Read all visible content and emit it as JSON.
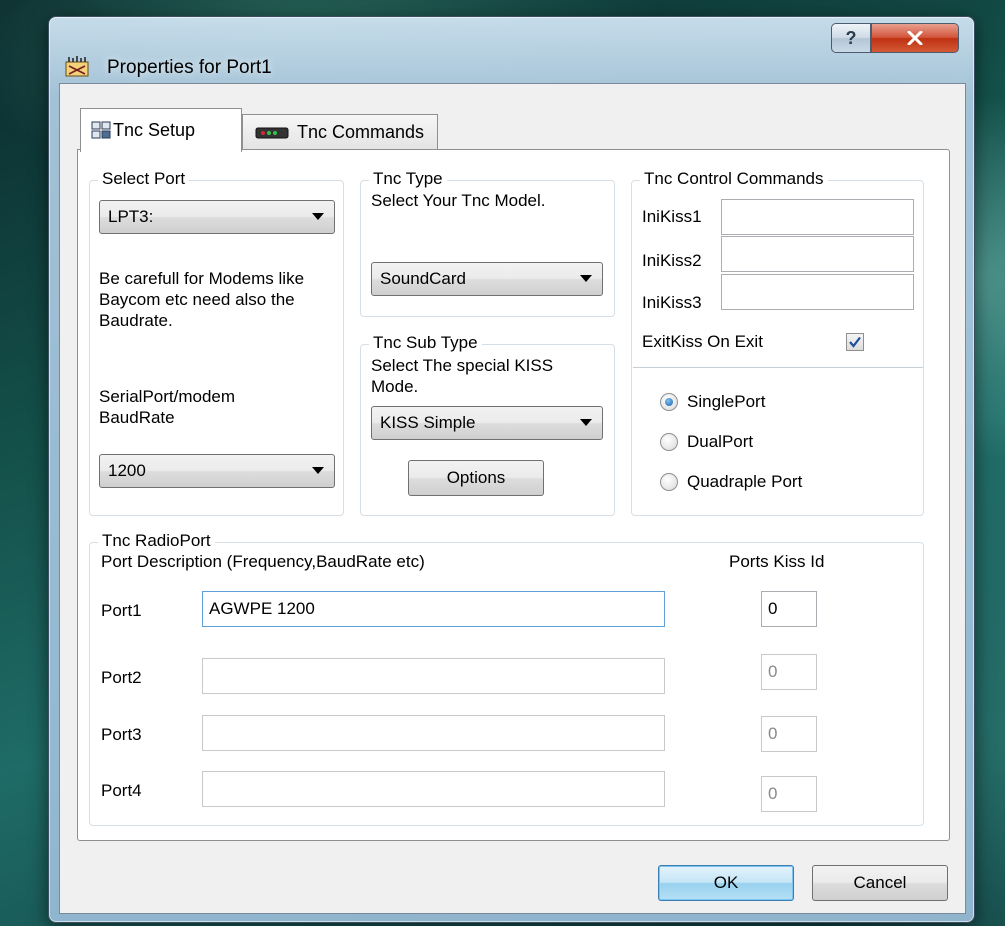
{
  "window": {
    "title": "Properties for Port1"
  },
  "tabs": [
    {
      "label": "Tnc Setup",
      "icon": "tnc-setup-icon",
      "selected": true
    },
    {
      "label": "Tnc Commands",
      "icon": "modem-icon",
      "selected": false
    }
  ],
  "select_port": {
    "legend": "Select Port",
    "port_value": "LPT3:",
    "note": "Be carefull for Modems like Baycom etc need also the Baudrate.",
    "baud_label": "SerialPort/modem BaudRate",
    "baud_value": "1200"
  },
  "tnc_type": {
    "legend": "Tnc Type",
    "hint": "Select Your Tnc Model.",
    "value": "SoundCard"
  },
  "tnc_sub_type": {
    "legend": "Tnc Sub Type",
    "hint": "Select The special KISS Mode.",
    "value": "KISS Simple",
    "options_label": "Options"
  },
  "control_commands": {
    "legend": "Tnc Control Commands",
    "inikiss1_label": "IniKiss1",
    "inikiss2_label": "IniKiss2",
    "inikiss3_label": "IniKiss3",
    "inikiss1_value": "",
    "inikiss2_value": "",
    "inikiss3_value": "",
    "exitkiss_label": "ExitKiss On Exit",
    "exitkiss_checked": true,
    "radios": [
      {
        "label": "SinglePort",
        "checked": true
      },
      {
        "label": "DualPort",
        "checked": false
      },
      {
        "label": "Quadraple Port",
        "checked": false
      }
    ]
  },
  "radio_port": {
    "legend": "Tnc RadioPort",
    "description_header": "Port Description (Frequency,BaudRate etc)",
    "kiss_id_header": "Ports Kiss Id",
    "ports": [
      {
        "label": "Port1",
        "description": "AGWPE 1200",
        "kiss_id": "0",
        "enabled": true
      },
      {
        "label": "Port2",
        "description": "",
        "kiss_id": "0",
        "enabled": false
      },
      {
        "label": "Port3",
        "description": "",
        "kiss_id": "0",
        "enabled": false
      },
      {
        "label": "Port4",
        "description": "",
        "kiss_id": "0",
        "enabled": false
      }
    ]
  },
  "footer": {
    "ok_label": "OK",
    "cancel_label": "Cancel"
  },
  "colors": {
    "accent": "#3c7fb1",
    "close_red": "#c4391a",
    "group_border": "#d5dfe5"
  }
}
